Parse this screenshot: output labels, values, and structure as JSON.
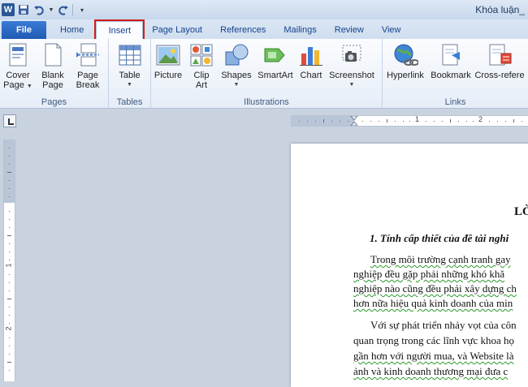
{
  "app": {
    "logo_letter": "W",
    "title": "Khóa luận_"
  },
  "tabs": [
    {
      "label": "File"
    },
    {
      "label": "Home"
    },
    {
      "label": "Insert"
    },
    {
      "label": "Page Layout"
    },
    {
      "label": "References"
    },
    {
      "label": "Mailings"
    },
    {
      "label": "Review"
    },
    {
      "label": "View"
    }
  ],
  "ribbon": {
    "groups": {
      "pages": "Pages",
      "tables": "Tables",
      "illustrations": "Illustrations",
      "links": "Links"
    },
    "buttons": {
      "cover_page_1": "Cover",
      "cover_page_2": "Page",
      "blank_page_1": "Blank",
      "blank_page_2": "Page",
      "page_break_1": "Page",
      "page_break_2": "Break",
      "table": "Table",
      "picture": "Picture",
      "clip_art_1": "Clip",
      "clip_art_2": "Art",
      "shapes": "Shapes",
      "smartart": "SmartArt",
      "chart": "Chart",
      "screenshot": "Screenshot",
      "hyperlink": "Hyperlink",
      "bookmark": "Bookmark",
      "cross_reference": "Cross-refere"
    }
  },
  "ruler": {
    "h_marks": [
      "1",
      "2"
    ],
    "v_marks": [
      "1",
      "2"
    ]
  },
  "document": {
    "heading_fragment": "LỜ",
    "section_title": "1.  Tính cấp thiết của đề tài nghi",
    "para1": [
      "Trong môi trường cạnh tranh gay",
      "nghiệp đều gặp phải những khó khă",
      "nghiệp nào cũng đều phải xây dựng ch",
      "hơn nữa hiệu quả kinh doanh của min"
    ],
    "para2": [
      "Với sự phát triển nhảy vọt của côn",
      "quan trọng trong các lĩnh vực khoa họ",
      "gần hơn với người mua, và Website là",
      "ảnh và kinh doanh thương mại đưa c"
    ]
  }
}
